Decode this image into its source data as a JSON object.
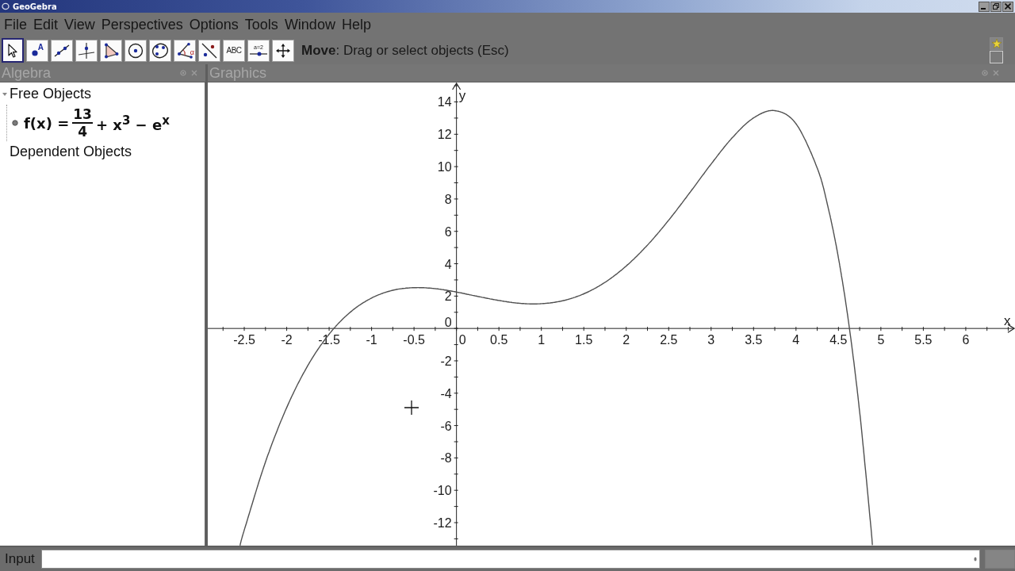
{
  "window": {
    "title": "GeoGebra"
  },
  "menu": [
    "File",
    "Edit",
    "View",
    "Perspectives",
    "Options",
    "Tools",
    "Window",
    "Help"
  ],
  "toolbar": {
    "tools": [
      {
        "kind": "move",
        "selected": true
      },
      {
        "kind": "point",
        "label": "A",
        "selected": false
      },
      {
        "kind": "line",
        "selected": false
      },
      {
        "kind": "perpendicular",
        "selected": false
      },
      {
        "kind": "polygon",
        "selected": false
      },
      {
        "kind": "circle",
        "selected": false
      },
      {
        "kind": "conic",
        "selected": false
      },
      {
        "kind": "angle",
        "label": "α",
        "selected": false
      },
      {
        "kind": "reflect",
        "selected": false
      },
      {
        "kind": "text",
        "label": "ABC",
        "selected": false
      },
      {
        "kind": "slider",
        "label": "a=2",
        "selected": false
      },
      {
        "kind": "move-view",
        "selected": false
      }
    ],
    "help_text": "**Move**: Drag or select objects (Esc)"
  },
  "algebra": {
    "title": "Algebra",
    "groups": [
      {
        "label": "Free Objects",
        "expanded": true,
        "children": [
          {
            "visible": true,
            "formula": {
              "lhs": "f(x) =",
              "numerator": "13",
              "denominator": "4",
              "rest": "+ x$^{3}$ − e$^{x}$"
            }
          }
        ]
      },
      {
        "label": "Dependent Objects"
      }
    ]
  },
  "graphics": {
    "title": "Graphics",
    "chart_data": {
      "type": "line",
      "xlabel": "x",
      "ylabel": "y",
      "x": [
        -2.55,
        -2.5,
        -2.25,
        -2,
        -1.75,
        -1.5,
        -1.25,
        -1,
        -0.75,
        -0.5,
        -0.25,
        0,
        0.25,
        0.5,
        0.75,
        1,
        1.25,
        1.5,
        1.75,
        2,
        2.25,
        2.5,
        2.75,
        3,
        3.25,
        3.5,
        3.75,
        4,
        4.25,
        4.375,
        4.5,
        4.625,
        4.75,
        4.875,
        4.9
      ],
      "series": [
        {
          "color": "#505050",
          "values": [
            -13.41,
            -12.46,
            -8.25,
            -4.89,
            -2.28,
            -0.35,
            1.01,
            1.88,
            2.36,
            2.52,
            2.46,
            2.25,
            1.98,
            1.73,
            1.55,
            1.53,
            1.71,
            2.14,
            2.85,
            3.86,
            5.15,
            6.69,
            8.4,
            10.16,
            11.79,
            13.01,
            13.46,
            12.65,
            9.91,
            7.55,
            4.36,
            0.18,
            -5.16,
            -11.87,
            -13.39
          ]
        }
      ],
      "xlim": [
        -2.93,
        6.58
      ],
      "ylim": [
        -13.42,
        15.2
      ],
      "xticks": [
        -2.5,
        -2,
        -1.5,
        -1,
        -0.5,
        0,
        0.5,
        1,
        1.5,
        2,
        2.5,
        3,
        3.5,
        4,
        4.5,
        5,
        5.5,
        6
      ],
      "yticks": [
        -12,
        -10,
        -8,
        -6,
        -4,
        -2,
        0,
        2,
        4,
        6,
        8,
        10,
        12,
        14
      ]
    }
  },
  "input_bar": {
    "label": "Input"
  }
}
